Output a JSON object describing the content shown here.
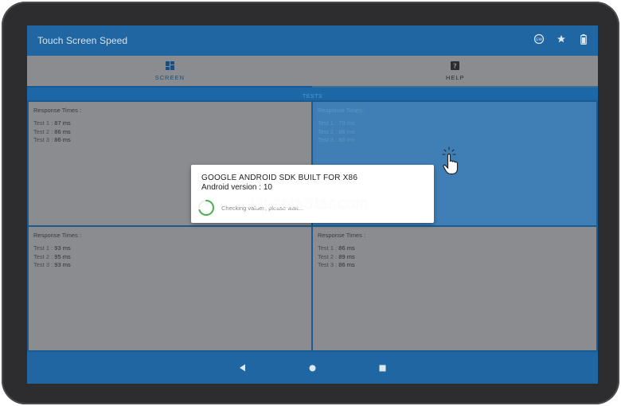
{
  "app": {
    "title": "Touch Screen Speed",
    "actions": [
      "speed-badge-icon",
      "star-icon",
      "battery-icon"
    ]
  },
  "tabs": [
    {
      "label": "SCREEN",
      "icon": "grid-icon",
      "active": true
    },
    {
      "label": "HELP",
      "icon": "help-icon",
      "active": false
    }
  ],
  "strip_label": "TESTS",
  "cells": [
    {
      "heading": "Response Times :",
      "tests": [
        {
          "label": "Test 1 :",
          "value": "87 ms"
        },
        {
          "label": "Test 2 :",
          "value": "86 ms"
        },
        {
          "label": "Test 3 :",
          "value": "86 ms"
        }
      ]
    },
    {
      "heading": "Response Times :",
      "tests": [
        {
          "label": "Test 1 :",
          "value": "79 ms"
        },
        {
          "label": "Test 2 :",
          "value": "86 ms"
        },
        {
          "label": "Test 3 :",
          "value": "86 ms"
        }
      ]
    },
    {
      "heading": "Response Times :",
      "tests": [
        {
          "label": "Test 1 :",
          "value": "93 ms"
        },
        {
          "label": "Test 2 :",
          "value": "95 ms"
        },
        {
          "label": "Test 3 :",
          "value": "93 ms"
        }
      ]
    },
    {
      "heading": "Response Times :",
      "tests": [
        {
          "label": "Test 1 :",
          "value": "86 ms"
        },
        {
          "label": "Test 2 :",
          "value": "89 ms"
        },
        {
          "label": "Test 3 :",
          "value": "86 ms"
        }
      ]
    }
  ],
  "dialog": {
    "device": "GOOGLE ANDROID SDK BUILT FOR X86",
    "version": "Android version  : 10",
    "status": "Checking values, please wait..."
  },
  "watermark": "UpdateStar.com",
  "nav": [
    "back-icon",
    "home-icon",
    "recents-icon"
  ],
  "colors": {
    "app_bar": "#1f66a3",
    "accent": "#1c4e7d",
    "spinner": "#4caf50"
  }
}
